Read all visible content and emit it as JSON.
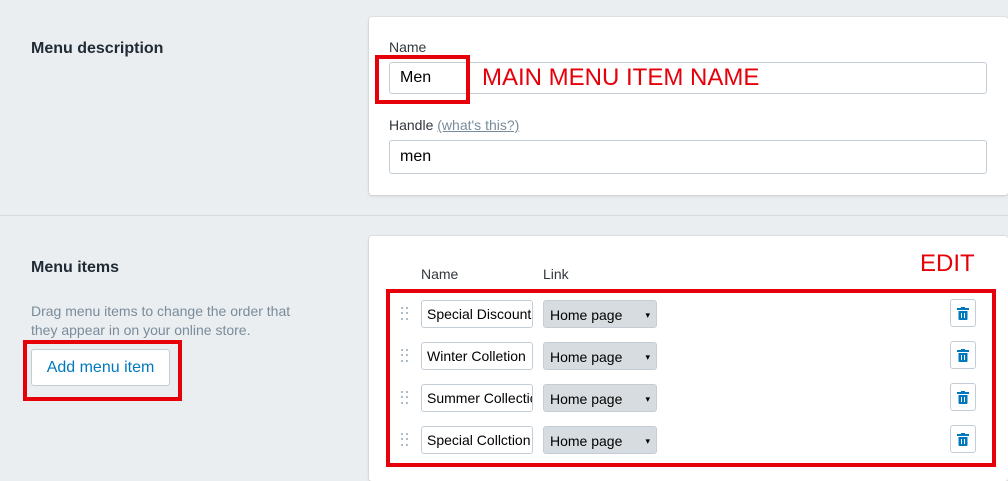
{
  "menu_description": {
    "title": "Menu description",
    "name_label": "Name",
    "name_value": "Men",
    "handle_label": "Handle",
    "handle_help_link": "(what's this?)",
    "handle_value": "men"
  },
  "menu_items": {
    "title": "Menu items",
    "help_line1": "Drag menu items to change the order that",
    "help_line2": "they appear in on your online store.",
    "add_button": "Add menu item",
    "col_name": "Name",
    "col_link": "Link",
    "items": [
      {
        "name": "Special Discount",
        "link": "Home page"
      },
      {
        "name": "Winter Colletion",
        "link": "Home page"
      },
      {
        "name": "Summer Collection",
        "link": "Home page"
      },
      {
        "name": "Special Collction",
        "link": "Home page"
      }
    ]
  },
  "annotations": {
    "main_menu_label": "MAIN MENU ITEM NAME",
    "edit_label": "EDIT",
    "highlight_color": "#e5000a"
  },
  "icons": {
    "drag": "drag-handle-icon",
    "trash": "trash-icon",
    "select_arrow": "▾"
  },
  "colors": {
    "background": "#ebeef0",
    "link_blue": "#0078bd",
    "trash_blue": "#0078bd"
  }
}
